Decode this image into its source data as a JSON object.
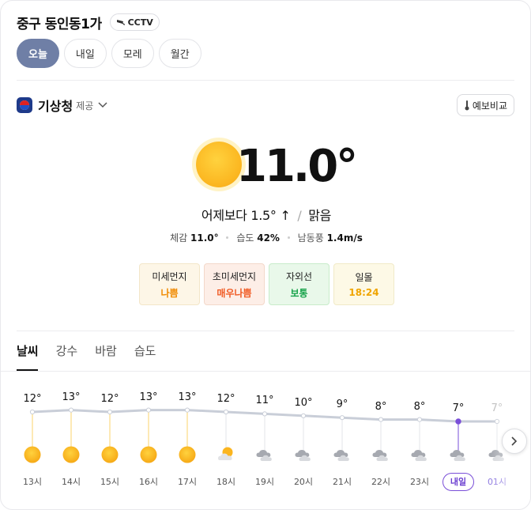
{
  "location": {
    "title": "중구 동인동1가",
    "cctv_label": "CCTV"
  },
  "day_tabs": [
    {
      "label": "오늘",
      "active": true
    },
    {
      "label": "내일",
      "active": false
    },
    {
      "label": "모레",
      "active": false
    },
    {
      "label": "월간",
      "active": false
    }
  ],
  "provider": {
    "name": "기상청",
    "sub": "제공",
    "icon": "kma-logo-icon"
  },
  "compare_button": {
    "label": "예보비교",
    "icon": "thermometer-icon"
  },
  "current": {
    "temp": "11.0°",
    "condition_icon": "sun-icon",
    "compare_text": "어제보다 1.5°",
    "compare_arrow": "↑",
    "condition": "맑음",
    "feels_like_label": "체감",
    "feels_like": "11.0°",
    "humidity_label": "습도",
    "humidity": "42%",
    "wind_label": "남동풍",
    "wind": "1.4m/s"
  },
  "badges": [
    {
      "label": "미세먼지",
      "value": "나쁨",
      "color": "#f08a00"
    },
    {
      "label": "초미세먼지",
      "value": "매우나쁨",
      "color": "#f05a24"
    },
    {
      "label": "자외선",
      "value": "보통",
      "color": "#17a34a"
    },
    {
      "label": "일몰",
      "value": "18:24",
      "color": "#f0a500"
    }
  ],
  "sub_tabs": [
    {
      "label": "날씨",
      "active": true
    },
    {
      "label": "강수",
      "active": false
    },
    {
      "label": "바람",
      "active": false
    },
    {
      "label": "습도",
      "active": false
    }
  ],
  "hourly": [
    {
      "hour": "13시",
      "temp": "12°",
      "temp_value": 12,
      "icon": "sun-icon"
    },
    {
      "hour": "14시",
      "temp": "13°",
      "temp_value": 13,
      "icon": "sun-icon"
    },
    {
      "hour": "15시",
      "temp": "12°",
      "temp_value": 12,
      "icon": "sun-icon"
    },
    {
      "hour": "16시",
      "temp": "13°",
      "temp_value": 13,
      "icon": "sun-icon"
    },
    {
      "hour": "17시",
      "temp": "13°",
      "temp_value": 13,
      "icon": "sun-icon"
    },
    {
      "hour": "18시",
      "temp": "12°",
      "temp_value": 12,
      "icon": "partly-cloudy-icon"
    },
    {
      "hour": "19시",
      "temp": "11°",
      "temp_value": 11,
      "icon": "cloudy-icon"
    },
    {
      "hour": "20시",
      "temp": "10°",
      "temp_value": 10,
      "icon": "cloudy-icon"
    },
    {
      "hour": "21시",
      "temp": "9°",
      "temp_value": 9,
      "icon": "cloudy-icon"
    },
    {
      "hour": "22시",
      "temp": "8°",
      "temp_value": 8,
      "icon": "cloudy-icon"
    },
    {
      "hour": "23시",
      "temp": "8°",
      "temp_value": 8,
      "icon": "cloudy-icon"
    },
    {
      "hour": "내일",
      "temp": "7°",
      "temp_value": 7,
      "icon": "cloudy-icon",
      "tomorrow": true
    },
    {
      "hour": "01시",
      "temp": "7°",
      "temp_value": 7,
      "icon": "cloudy-icon",
      "faded": true
    }
  ],
  "colors": {
    "accent": "#6f7fa6",
    "tomorrow": "#7a4fd8",
    "line": "#c9ced8"
  }
}
